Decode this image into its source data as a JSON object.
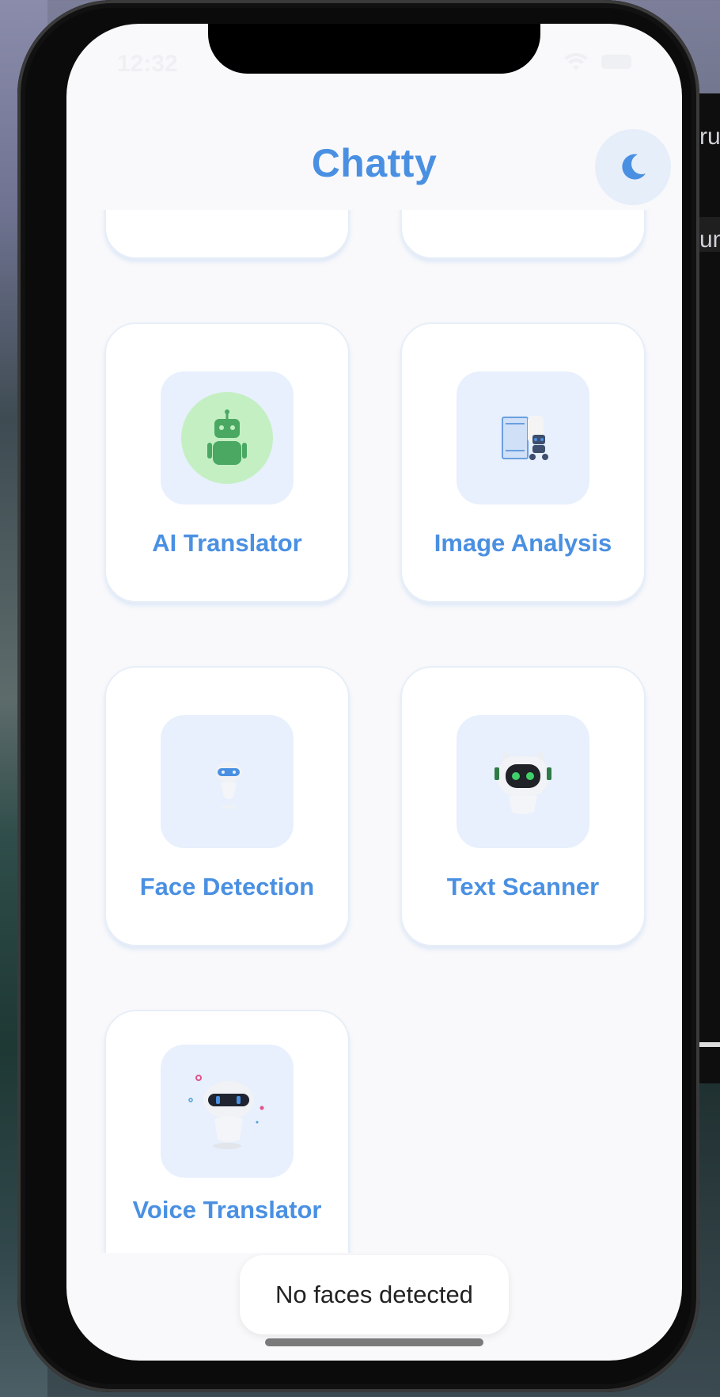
{
  "status_bar": {
    "time": "12:32"
  },
  "header": {
    "title": "Chatty",
    "theme_toggle_icon": "moon-icon"
  },
  "features": [
    {
      "label": "AI Translator",
      "icon": "green-robot-icon"
    },
    {
      "label": "Image Analysis",
      "icon": "robot-with-document-icon"
    },
    {
      "label": "Face Detection",
      "icon": "small-robot-icon"
    },
    {
      "label": "Text Scanner",
      "icon": "cat-robot-icon"
    },
    {
      "label": "Voice Translator",
      "icon": "voice-robot-icon"
    }
  ],
  "toast": {
    "message": "No faces detected"
  },
  "background_window": {
    "fragment_1": "ru",
    "fragment_2": "um"
  },
  "colors": {
    "accent": "#4a90e2",
    "tile_bg": "#e7f0fc",
    "screen_bg": "#f9f9fb"
  }
}
